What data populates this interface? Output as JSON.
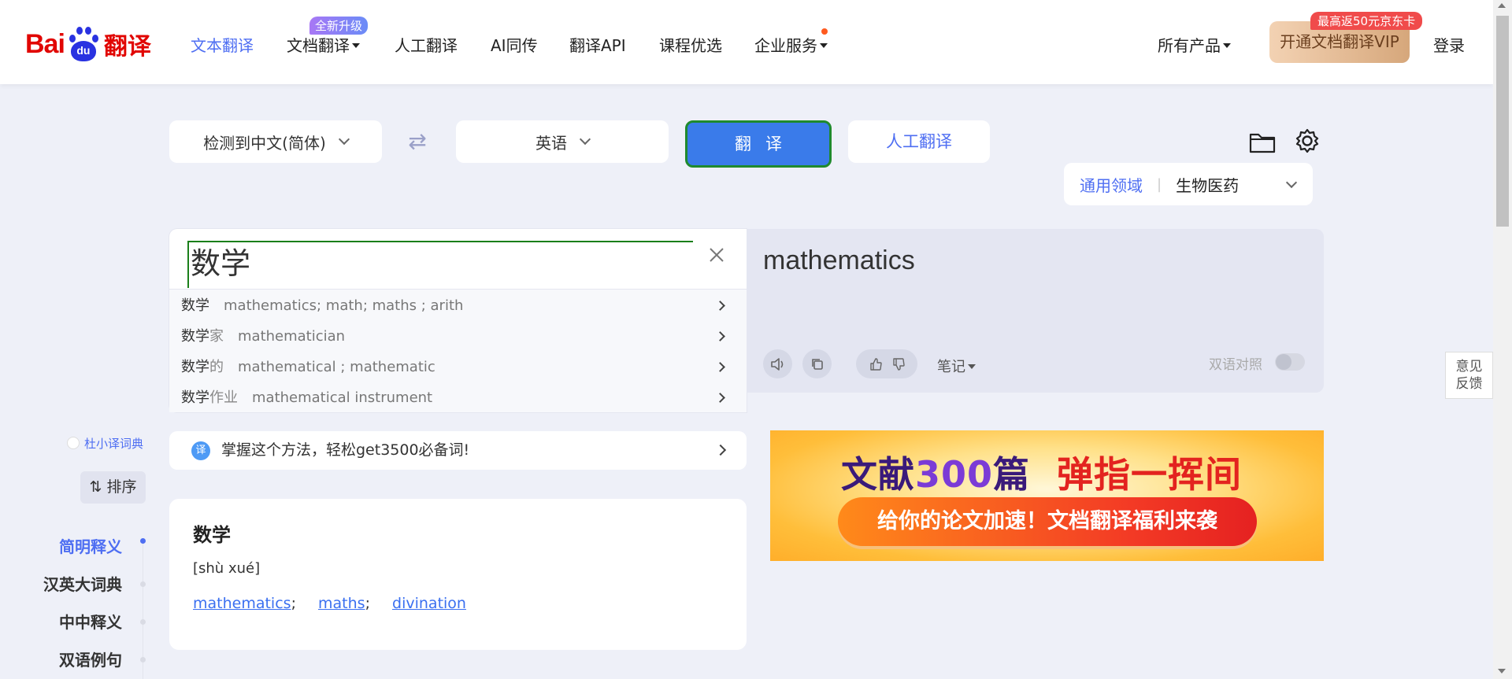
{
  "header": {
    "logo": {
      "bai": "Bai",
      "du": "du",
      "fanyi": "翻译"
    },
    "nav": [
      {
        "label": "文本翻译"
      },
      {
        "label": "文档翻译"
      },
      {
        "label": "人工翻译"
      },
      {
        "label": "AI同传"
      },
      {
        "label": "翻译API"
      },
      {
        "label": "课程优选"
      },
      {
        "label": "企业服务"
      }
    ],
    "doc_badge": "全新升级",
    "all_products": "所有产品",
    "vip_button": "开通文档翻译VIP",
    "vip_badge": "最高返50元京东卡",
    "login": "登录"
  },
  "toolbar": {
    "source_lang": "检测到中文(简体)",
    "target_lang": "英语",
    "translate_button": "翻译",
    "human_translate": "人工翻译",
    "domain_general": "通用领域",
    "domain_sep": "|",
    "domain_selected": "生物医药"
  },
  "input": {
    "value": "数学",
    "suggestions": [
      {
        "word": "数学",
        "suffix": "",
        "def": "mathematics; math; maths ; arith"
      },
      {
        "word": "数学",
        "suffix": "家",
        "def": "mathematician"
      },
      {
        "word": "数学",
        "suffix": "的",
        "def": "mathematical ; mathematic"
      },
      {
        "word": "数学",
        "suffix": "作业",
        "def": "mathematical instrument"
      }
    ]
  },
  "output": {
    "text": "mathematics",
    "notes": "笔记",
    "bilingual": "双语对照",
    "bilingual_on": false
  },
  "feedback": {
    "line1": "意见",
    "line2": "反馈"
  },
  "sidebar": {
    "duxiao": "杜小译词典",
    "sort": "排序",
    "items": [
      {
        "label": "简明释义",
        "active": true
      },
      {
        "label": "汉英大词典",
        "active": false
      },
      {
        "label": "中中释义",
        "active": false
      },
      {
        "label": "双语例句",
        "active": false
      }
    ]
  },
  "promo": {
    "icon": "译",
    "text": "掌握这个方法，轻松get3500必备词!"
  },
  "dictionary": {
    "word": "数学",
    "pinyin": "[shù xué]",
    "definitions": [
      "mathematics",
      "maths",
      "divination"
    ]
  },
  "banner": {
    "title_a": "文献",
    "title_num": "300",
    "title_b": "篇",
    "title_red": "弹指一挥间",
    "subtitle": "给你的论文加速！文档翻译福利来袭"
  },
  "colors": {
    "accent": "#4e6ef2",
    "translate_btn": "#3a7bea",
    "logo_red": "#e10602",
    "logo_blue": "#2932e1"
  }
}
